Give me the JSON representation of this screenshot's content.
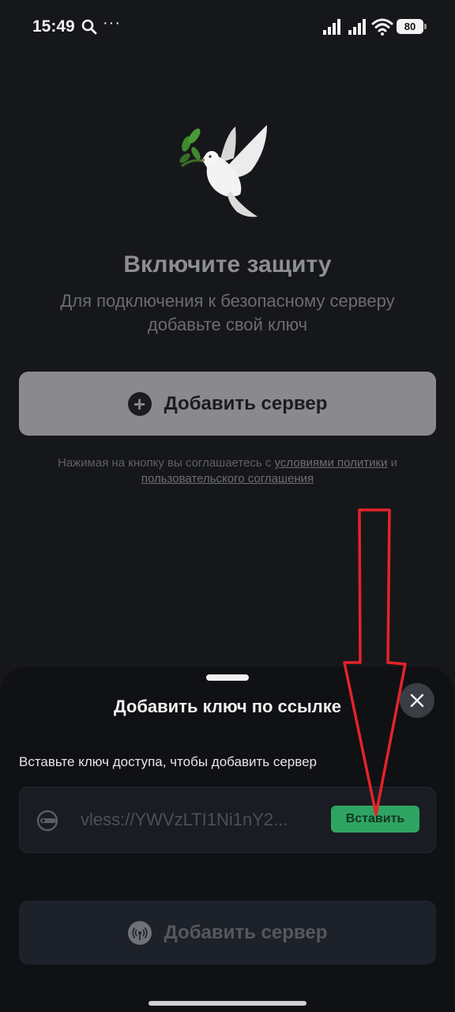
{
  "status_bar": {
    "time": "15:49",
    "more_glyph": "···",
    "battery": "80",
    "icons": [
      "search-icon",
      "signal-icon",
      "signal-icon",
      "wifi-icon",
      "battery-icon"
    ]
  },
  "main": {
    "illustration": "dove-with-olive-branch",
    "title": "Включите защиту",
    "subtitle": "Для подключения к безопасному серверу добавьте свой ключ",
    "add_server_label": "Добавить сервер",
    "terms": {
      "prefix": "Нажимая на кнопку вы соглашаетесь с ",
      "policy_link": "условиями политики",
      "middle": " и ",
      "agreement_link": "пользовательского соглашения"
    }
  },
  "sheet": {
    "title": "Добавить ключ по ссылке",
    "instruction": "Вставьте ключ доступа, чтобы добавить сервер",
    "key_value": "vless://YWVzLTI1Ni1nY2...",
    "paste_label": "Вставить",
    "add_server_label": "Добавить сервер"
  },
  "colors": {
    "background": "#16171b",
    "sheet": "#101115",
    "paste_green": "#2fa462",
    "annotation_red": "#e5232a"
  }
}
